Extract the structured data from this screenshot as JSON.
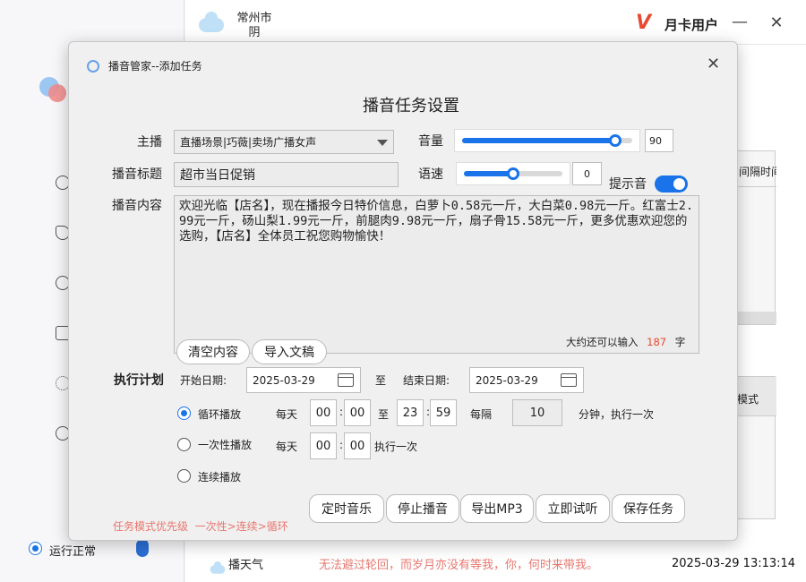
{
  "app": {
    "weather_city": "常州市",
    "weather_state": "阴",
    "user_label": "月卡用户",
    "logo_text": "V",
    "minimize": "—",
    "close": "✕",
    "right_panel_header1": "间隔时间",
    "right_panel_header2": "模式",
    "status_text": "运行正常",
    "weather_button": "播天气",
    "quote": "无法避过轮回，而岁月亦没有等我，你，何时来带我。",
    "datetime": "2025-03-29 13:13:14",
    "colors": {
      "accent": "#1a73e8",
      "brand": "#e8482f",
      "quote": "#e8776f"
    }
  },
  "dialog": {
    "window_title": "播音管家--添加任务",
    "close_icon": "✕",
    "heading": "播音任务设置",
    "anchor_label": "主播",
    "anchor_value": "直播场景|巧薇|卖场广播女声",
    "volume_label": "音量",
    "volume_value": "90",
    "volume_level": 0.9,
    "title_label": "播音标题",
    "title_value": "超市当日促销",
    "speed_label": "语速",
    "speed_value": "0",
    "speed_level": 0.5,
    "prompt_label": "提示音",
    "prompt_on": true,
    "content_label": "播音内容",
    "content_text": "欢迎光临【店名】，现在播报今日特价信息，白萝卜0.58元一斤，大白菜0.98元一斤。红富士2.99元一斤，砀山梨1.99元一斤，前腿肉9.98元一斤，扇子骨15.58元一斤，更多优惠欢迎您的选购，【店名】全体员工祝您购物愉快！",
    "remaining_prefix": "大约还可以输入",
    "remaining_count": "187",
    "remaining_suffix": "字",
    "clear_button": "清空内容",
    "import_button": "导入文稿",
    "plan_label": "执行计划",
    "start_label": "开始日期:",
    "start_date": "2025-03-29",
    "to_label": "至",
    "end_label": "结束日期:",
    "end_date": "2025-03-29",
    "loop_label": "循环播放",
    "every_day": "每天",
    "loop_start_h": "00",
    "loop_start_m": "00",
    "loop_to": "至",
    "loop_end_h": "23",
    "loop_end_m": "59",
    "interval_label": "每隔",
    "interval_value": "10",
    "interval_suffix": "分钟，执行一次",
    "once_label": "一次性播放",
    "once_every_day": "每天",
    "once_h": "00",
    "once_m": "00",
    "once_suffix": "执行一次",
    "continuous_label": "连续播放",
    "colon": ":",
    "priority_note": "任务模式优先级  一次性>连续>循环",
    "buttons": {
      "timer_music": "定时音乐",
      "stop": "停止播音",
      "export": "导出MP3",
      "try": "立即试听",
      "save": "保存任务"
    }
  }
}
